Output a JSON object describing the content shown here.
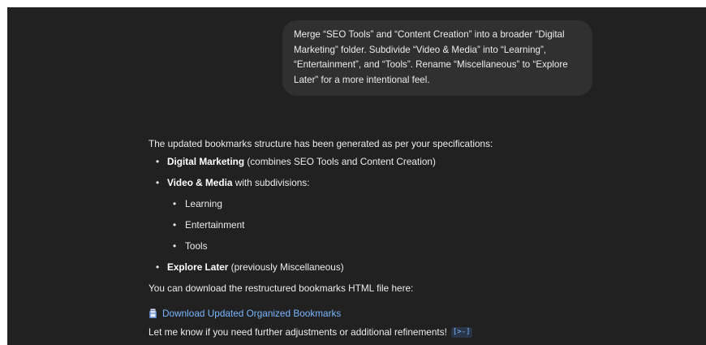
{
  "user_message": {
    "text": "Merge “SEO Tools” and “Content Creation” into a broader “Digital Marketing” folder. Subdivide “Video & Media” into “Learning”, “Entertainment”, and “Tools”. Rename “Miscellaneous” to “Explore Later” for a more intentional feel."
  },
  "assistant": {
    "intro": "The updated bookmarks structure has been generated as per your specifications:",
    "bullets": [
      {
        "bold": "Digital Marketing",
        "rest": " (combines SEO Tools and Content Creation)"
      },
      {
        "bold": "Video & Media",
        "rest": " with subdivisions:"
      },
      {
        "bold": "Explore Later",
        "rest": " (previously Miscellaneous)"
      }
    ],
    "subitems": [
      "Learning",
      "Entertainment",
      "Tools"
    ],
    "download_note": "You can download the restructured bookmarks HTML file here:",
    "download_link": "Download Updated Organized Bookmarks",
    "closing": "Let me know if you need further adjustments or additional refinements!",
    "source_chip": "[>-]",
    "file_icon": "file-icon",
    "link_color": "#7ab7ff"
  }
}
